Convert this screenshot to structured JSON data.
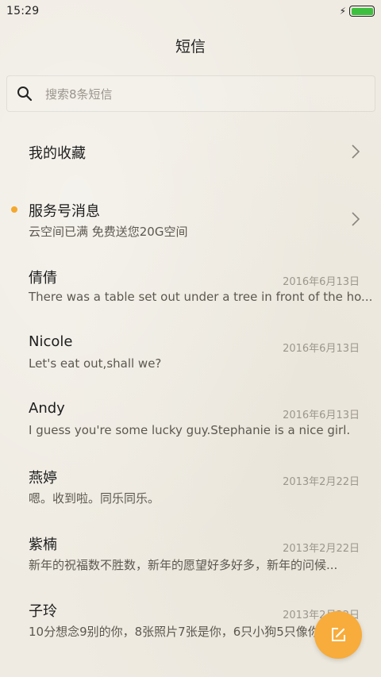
{
  "status_bar": {
    "time": "15:29"
  },
  "header": {
    "title": "短信"
  },
  "search": {
    "placeholder": "搜索8条短信"
  },
  "accent_color": "#f7ac3b",
  "unread_dot_color": "#f4a82e",
  "battery_color": "#3fbf3f",
  "favorites": {
    "label": "我的收藏"
  },
  "service": {
    "title": "服务号消息",
    "preview": "云空间已满 免费送您20G空间",
    "unread": true
  },
  "conversations": [
    {
      "name": "倩倩",
      "date": "2016年6月13日",
      "preview": "There was a table set out under a tree in front of the ho..."
    },
    {
      "name": "Nicole",
      "date": "2016年6月13日",
      "preview": "Let's eat out,shall we?"
    },
    {
      "name": "Andy",
      "date": "2016年6月13日",
      "preview": "I guess you're some lucky guy.Stephanie is a nice girl."
    },
    {
      "name": "燕婷",
      "date": "2013年2月22日",
      "preview": "嗯。收到啦。同乐同乐。"
    },
    {
      "name": "紫楠",
      "date": "2013年2月22日",
      "preview": "新年的祝福数不胜数，新年的愿望好多好多，新年的问候..."
    },
    {
      "name": "子玲",
      "date": "2013年2月22日",
      "preview": "10分想念9别的你，8张照片7张是你，6只小狗5只像你..."
    }
  ],
  "icons": {
    "search": "search-icon",
    "chevron": "chevron-right-icon",
    "compose": "compose-icon",
    "bolt": "charging-bolt-icon",
    "battery": "battery-icon"
  }
}
